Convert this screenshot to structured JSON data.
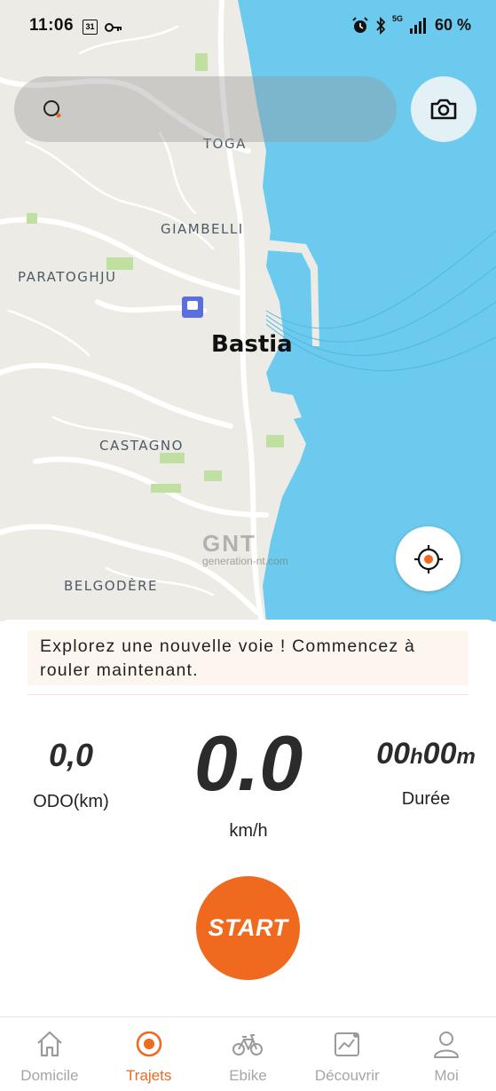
{
  "status_bar": {
    "time": "11:06",
    "calendar_day": "31",
    "battery": "60 %",
    "network": "5G"
  },
  "map": {
    "labels": {
      "toga": "TOGA",
      "giambelli": "GIAMBELLI",
      "paratoghju": "PARATOGHJU",
      "bastia": "Bastia",
      "castagno": "CASTAGNO",
      "belgodere": "BELGODÈRE"
    },
    "watermark": {
      "logo": "GNT",
      "site": "generation-nt.com"
    },
    "colors": {
      "land": "#ecebe6",
      "sea": "#6ccaee",
      "green": "#bfe0a1"
    }
  },
  "banner": {
    "text": "Explorez une nouvelle voie ! Commencez à rouler maintenant."
  },
  "stats": {
    "odo_value": "0,0",
    "odo_label": "ODO(km)",
    "speed_value": "0.0",
    "speed_label": "km/h",
    "duration_hours": "00",
    "duration_h": "h",
    "duration_minutes": "00",
    "duration_m": "m",
    "duration_label": "Durée"
  },
  "start_button": {
    "label": "START",
    "color": "#ef6a1e"
  },
  "tabs": [
    {
      "label": "Domicile",
      "icon": "home-icon",
      "active": false
    },
    {
      "label": "Trajets",
      "icon": "record-icon",
      "active": true
    },
    {
      "label": "Ebike",
      "icon": "bike-icon",
      "active": false
    },
    {
      "label": "Découvrir",
      "icon": "chart-icon",
      "active": false
    },
    {
      "label": "Moi",
      "icon": "user-icon",
      "active": false
    }
  ]
}
